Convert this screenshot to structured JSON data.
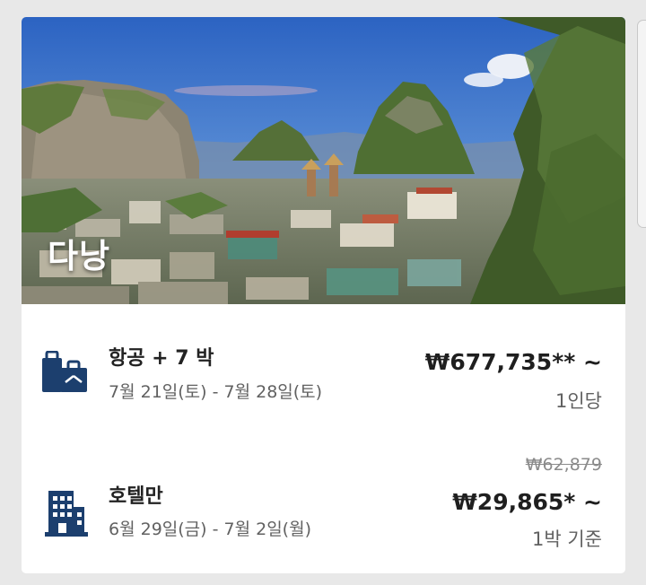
{
  "destination": {
    "title": "다낭"
  },
  "flight_package": {
    "title": "항공 + 7 박",
    "dates": "7월 21일(토) - 7월 28일(토)",
    "price": "₩677,735** ~",
    "price_unit": "1인당",
    "icon": "luggage-icon"
  },
  "hotel_only": {
    "title": "호텔만",
    "dates": "6월 29일(금) - 7월 2일(월)",
    "original_price": "₩62,879",
    "price": "₩29,865* ~",
    "price_unit": "1박 기준",
    "icon": "building-icon"
  },
  "colors": {
    "icon_navy": "#1c3f6e",
    "text_dark": "#222222",
    "text_gray": "#616161"
  }
}
